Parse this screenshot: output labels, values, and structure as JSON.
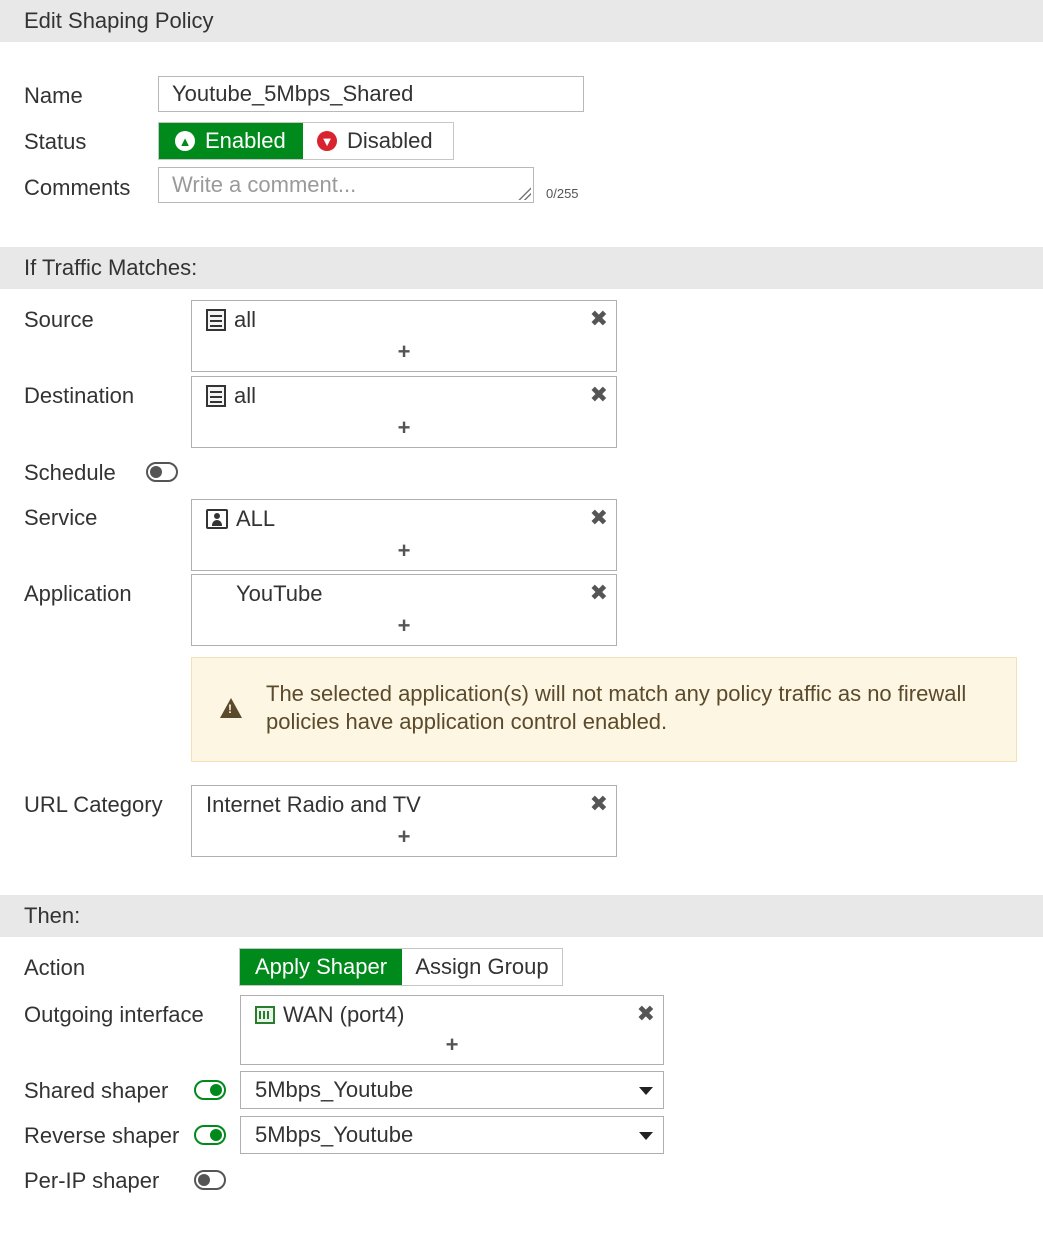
{
  "title": "Edit Shaping Policy",
  "fields": {
    "name_label": "Name",
    "name_value": "Youtube_5Mbps_Shared",
    "status_label": "Status",
    "status_enabled": "Enabled",
    "status_disabled": "Disabled",
    "status_selected": "Enabled",
    "comments_label": "Comments",
    "comments_placeholder": "Write a comment...",
    "comments_counter": "0/255"
  },
  "traffic": {
    "section_title": "If Traffic Matches:",
    "source_label": "Source",
    "source_items": [
      "all"
    ],
    "destination_label": "Destination",
    "destination_items": [
      "all"
    ],
    "schedule_label": "Schedule",
    "schedule_enabled": false,
    "service_label": "Service",
    "service_items": [
      "ALL"
    ],
    "application_label": "Application",
    "application_items": [
      "YouTube"
    ],
    "warning_text": "The selected application(s) will not match any policy traffic as no firewall policies have application control enabled.",
    "url_category_label": "URL Category",
    "url_category_items": [
      "Internet Radio and TV"
    ]
  },
  "then": {
    "section_title": "Then:",
    "action_label": "Action",
    "action_apply": "Apply Shaper",
    "action_assign": "Assign Group",
    "action_selected": "Apply Shaper",
    "outgoing_label": "Outgoing interface",
    "outgoing_items": [
      "WAN (port4)"
    ],
    "shared_label": "Shared shaper",
    "shared_enabled": true,
    "shared_value": "5Mbps_Youtube",
    "reverse_label": "Reverse shaper",
    "reverse_enabled": true,
    "reverse_value": "5Mbps_Youtube",
    "perip_label": "Per-IP shaper",
    "perip_enabled": false
  },
  "icons": {
    "add": "+",
    "remove": "✖"
  },
  "colors": {
    "accent_green": "#008a1c",
    "disabled_red": "#d9232e",
    "section_bg": "#e8e8e8",
    "warning_bg": "#fcf6e3"
  }
}
